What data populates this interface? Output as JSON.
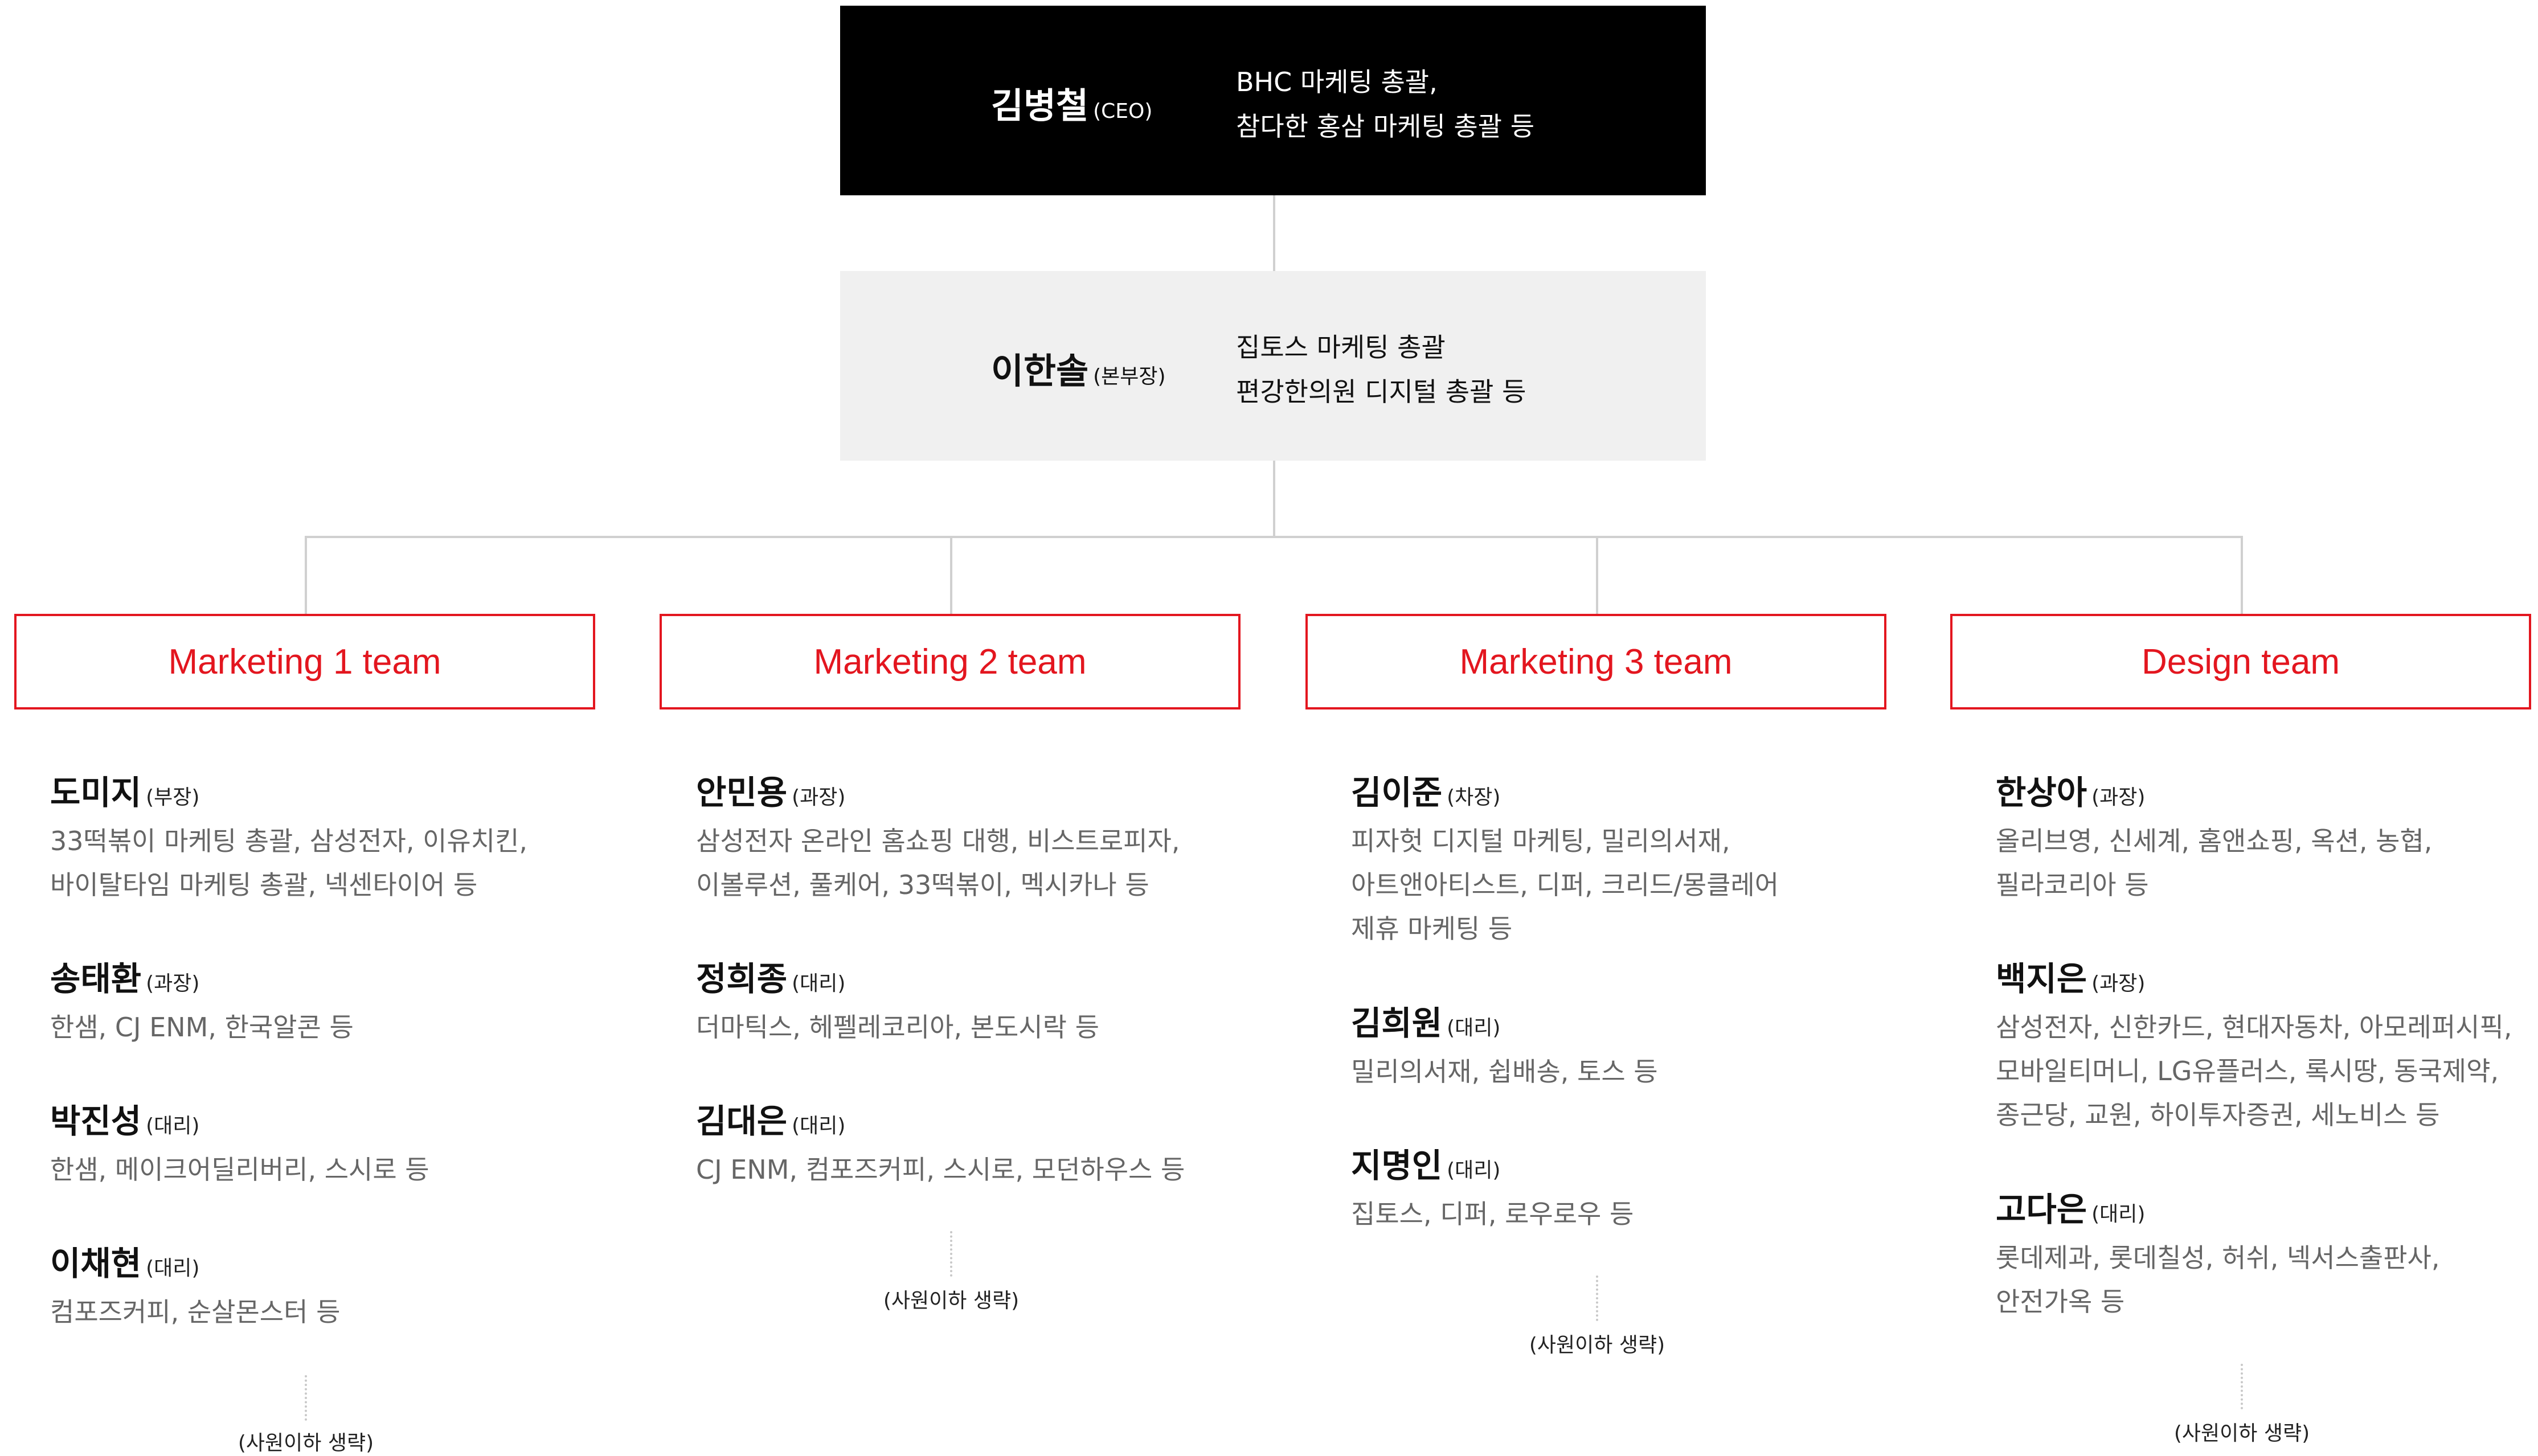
{
  "ceo": {
    "name": "김병철",
    "role": "(CEO)",
    "desc": [
      "BHC 마케팅 총괄,",
      "참다한 홍삼 마케팅 총괄 등"
    ]
  },
  "head": {
    "name": "이한솔",
    "role": "(본부장)",
    "desc": [
      "집토스 마케팅 총괄",
      "편강한의원 디지털 총괄 등"
    ]
  },
  "colors": {
    "accent": "#e3161f",
    "ceo_bg": "#000000",
    "head_bg": "#f0f0f0",
    "line": "#d0d0d0"
  },
  "teams": [
    {
      "name": "Marketing 1 team",
      "members": [
        {
          "name": "도미지",
          "role": "(부장)",
          "desc": [
            "33떡볶이 마케팅 총괄, 삼성전자, 이유치킨,",
            "바이탈타임 마케팅 총괄, 넥센타이어 등"
          ]
        },
        {
          "name": "송태환",
          "role": "(과장)",
          "desc": [
            "한샘, CJ ENM, 한국알콘 등"
          ]
        },
        {
          "name": "박진성",
          "role": "(대리)",
          "desc": [
            "한샘, 메이크어딜리버리, 스시로 등"
          ]
        },
        {
          "name": "이채현",
          "role": "(대리)",
          "desc": [
            "컴포즈커피, 순살몬스터 등"
          ]
        }
      ],
      "note": "(사원이하 생략)"
    },
    {
      "name": "Marketing 2 team",
      "members": [
        {
          "name": "안민용",
          "role": "(과장)",
          "desc": [
            "삼성전자 온라인 홈쇼핑 대행, 비스트로피자,",
            "이볼루션, 풀케어, 33떡볶이, 멕시카나 등"
          ]
        },
        {
          "name": "정희종",
          "role": "(대리)",
          "desc": [
            "더마틱스, 헤펠레코리아, 본도시락 등"
          ]
        },
        {
          "name": "김대은",
          "role": "(대리)",
          "desc": [
            "CJ ENM, 컴포즈커피, 스시로, 모던하우스 등"
          ]
        }
      ],
      "note": "(사원이하 생략)"
    },
    {
      "name": "Marketing 3 team",
      "members": [
        {
          "name": "김이준",
          "role": "(차장)",
          "desc": [
            "피자헛 디지털 마케팅, 밀리의서재,",
            "아트앤아티스트, 디퍼, 크리드/몽클레어",
            "제휴 마케팅 등"
          ]
        },
        {
          "name": "김희원",
          "role": "(대리)",
          "desc": [
            "밀리의서재, 쉽배송, 토스 등"
          ]
        },
        {
          "name": "지명인",
          "role": "(대리)",
          "desc": [
            "집토스, 디퍼, 로우로우 등"
          ]
        }
      ],
      "note": "(사원이하 생략)"
    },
    {
      "name": "Design team",
      "members": [
        {
          "name": "한상아",
          "role": "(과장)",
          "desc": [
            "올리브영, 신세계, 홈앤쇼핑, 옥션, 농협,",
            "필라코리아 등"
          ]
        },
        {
          "name": "백지은",
          "role": "(과장)",
          "desc": [
            "삼성전자, 신한카드, 현대자동차, 아모레퍼시픽,",
            "모바일티머니, LG유플러스, 록시땅, 동국제약,",
            "종근당, 교원, 하이투자증권, 세노비스 등"
          ]
        },
        {
          "name": "고다은",
          "role": "(대리)",
          "desc": [
            "롯데제과, 롯데칠성, 허쉬, 넥서스출판사,",
            "안전가옥 등"
          ]
        }
      ],
      "note": "(사원이하 생략)"
    }
  ]
}
